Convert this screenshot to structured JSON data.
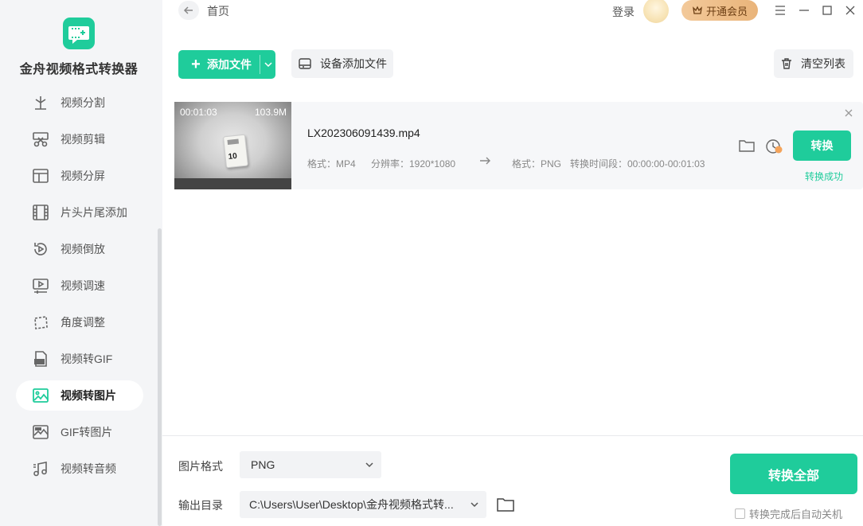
{
  "app": {
    "title": "金舟视频格式转换器"
  },
  "sidebar": {
    "items": [
      {
        "label": "视频分割",
        "icon": "split-icon"
      },
      {
        "label": "视频剪辑",
        "icon": "scissors-icon"
      },
      {
        "label": "视频分屏",
        "icon": "layout-icon"
      },
      {
        "label": "片头片尾添加",
        "icon": "film-strip-icon"
      },
      {
        "label": "视频倒放",
        "icon": "rewind-icon"
      },
      {
        "label": "视频调速",
        "icon": "monitor-speed-icon"
      },
      {
        "label": "角度调整",
        "icon": "rotate-icon"
      },
      {
        "label": "视频转GIF",
        "icon": "gif-file-icon"
      },
      {
        "label": "视频转图片",
        "icon": "image-icon",
        "active": true
      },
      {
        "label": "GIF转图片",
        "icon": "gif-image-icon"
      },
      {
        "label": "视频转音频",
        "icon": "music-icon"
      }
    ]
  },
  "topbar": {
    "breadcrumb": "首页",
    "login": "登录",
    "vip": "开通会员"
  },
  "toolbar": {
    "add_file": "添加文件",
    "device_add": "设备添加文件",
    "clear_list": "清空列表"
  },
  "files": [
    {
      "duration": "00:01:03",
      "size": "103.9M",
      "thumb_text": "10",
      "name": "LX202306091439.mp4",
      "src_format": "格式：MP4",
      "resolution": "分辨率：1920*1080",
      "dst_format": "格式：PNG",
      "time_range": "转换时间段：00:00:00-00:01:03",
      "convert_label": "转换",
      "status": "转换成功"
    }
  ],
  "bottom": {
    "format_label": "图片格式",
    "format_value": "PNG",
    "output_label": "输出目录",
    "output_value": "C:\\Users\\User\\Desktop\\金舟视频格式转...",
    "convert_all": "转换全部",
    "shutdown_label": "转换完成后自动关机"
  },
  "colors": {
    "accent": "#1fcc9b",
    "vip_bg": "#f3c99a"
  }
}
